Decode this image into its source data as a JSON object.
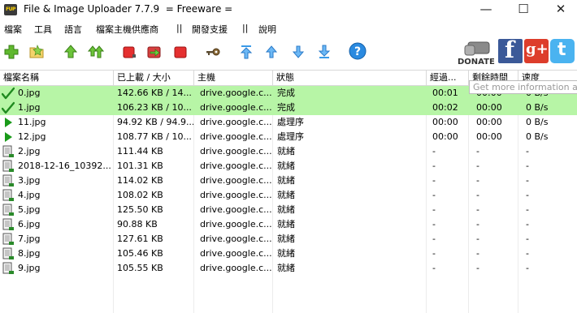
{
  "window": {
    "app_icon_text": "FUP",
    "title": "File & Image Uploader 7.7.9  = Freeware ="
  },
  "menu": [
    "檔案",
    "工具",
    "語言",
    "檔案主機供應商",
    "||",
    "開發支援",
    "||",
    "說明"
  ],
  "toolbar": {
    "buttons": [
      "add-files-icon",
      "add-folder-icon",
      "upload-selected-icon",
      "upload-all-icon",
      "stop-icon",
      "export-icon",
      "clear-icon",
      "key-icon",
      "move-top-icon",
      "move-up-icon",
      "move-down-icon",
      "move-bottom-icon",
      "help-icon"
    ],
    "donate_label": "DONATE",
    "facebook_label": "f",
    "googleplus_label": "g+",
    "twitter_label": "t"
  },
  "table": {
    "columns": [
      "檔案名稱",
      "已上載 / 大小",
      "主機",
      "狀態",
      "經過...",
      "剩餘時間",
      "速度"
    ],
    "tooltip": "Get more information about",
    "rows": [
      {
        "name": "0.jpg",
        "size": "142.66 KB / 14...",
        "host": "drive.google.c...",
        "status": "完成",
        "elapsed": "00:01",
        "remaining": "00:00",
        "speed": "0 B/s",
        "state": "done"
      },
      {
        "name": "1.jpg",
        "size": "106.23 KB / 10...",
        "host": "drive.google.c...",
        "status": "完成",
        "elapsed": "00:02",
        "remaining": "00:00",
        "speed": "0 B/s",
        "state": "done"
      },
      {
        "name": "11.jpg",
        "size": "94.92 KB / 94.9...",
        "host": "drive.google.c...",
        "status": "處理序",
        "elapsed": "00:00",
        "remaining": "00:00",
        "speed": "0 B/s",
        "state": "processing"
      },
      {
        "name": "12.jpg",
        "size": "108.77 KB / 10...",
        "host": "drive.google.c...",
        "status": "處理序",
        "elapsed": "00:00",
        "remaining": "00:00",
        "speed": "0 B/s",
        "state": "processing"
      },
      {
        "name": "2.jpg",
        "size": "111.44 KB",
        "host": "drive.google.c...",
        "status": "就緒",
        "elapsed": "-",
        "remaining": "-",
        "speed": "-",
        "state": "ready"
      },
      {
        "name": "2018-12-16_10392...",
        "size": "101.31 KB",
        "host": "drive.google.c...",
        "status": "就緒",
        "elapsed": "-",
        "remaining": "-",
        "speed": "-",
        "state": "ready"
      },
      {
        "name": "3.jpg",
        "size": "114.02 KB",
        "host": "drive.google.c...",
        "status": "就緒",
        "elapsed": "-",
        "remaining": "-",
        "speed": "-",
        "state": "ready"
      },
      {
        "name": "4.jpg",
        "size": "108.02 KB",
        "host": "drive.google.c...",
        "status": "就緒",
        "elapsed": "-",
        "remaining": "-",
        "speed": "-",
        "state": "ready"
      },
      {
        "name": "5.jpg",
        "size": "125.50 KB",
        "host": "drive.google.c...",
        "status": "就緒",
        "elapsed": "-",
        "remaining": "-",
        "speed": "-",
        "state": "ready"
      },
      {
        "name": "6.jpg",
        "size": "90.88 KB",
        "host": "drive.google.c...",
        "status": "就緒",
        "elapsed": "-",
        "remaining": "-",
        "speed": "-",
        "state": "ready"
      },
      {
        "name": "7.jpg",
        "size": "127.61 KB",
        "host": "drive.google.c...",
        "status": "就緒",
        "elapsed": "-",
        "remaining": "-",
        "speed": "-",
        "state": "ready"
      },
      {
        "name": "8.jpg",
        "size": "105.46 KB",
        "host": "drive.google.c...",
        "status": "就緒",
        "elapsed": "-",
        "remaining": "-",
        "speed": "-",
        "state": "ready"
      },
      {
        "name": "9.jpg",
        "size": "105.55 KB",
        "host": "drive.google.c...",
        "status": "就緒",
        "elapsed": "-",
        "remaining": "-",
        "speed": "-",
        "state": "ready"
      }
    ]
  },
  "colors": {
    "done_row_bg": "#b7f5a6",
    "check_green": "#1f8a1f",
    "play_green": "#1a9a1a"
  }
}
